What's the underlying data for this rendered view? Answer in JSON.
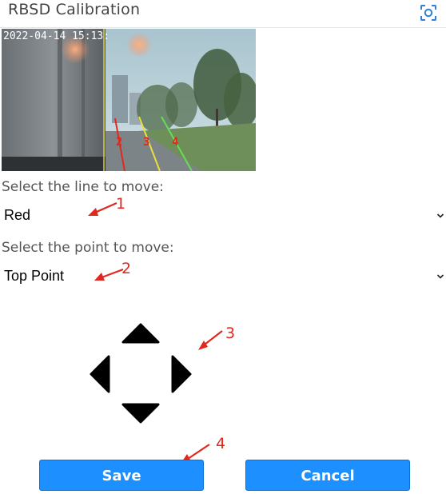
{
  "header": {
    "title": "RBSD Calibration",
    "scan_icon": "scan-focus-icon"
  },
  "camera": {
    "timestamp": "2022-04-14 15:13:",
    "line_labels": [
      "2",
      "3",
      "4"
    ],
    "line_colors": [
      "#e0281e",
      "#e8e040",
      "#66dd55"
    ]
  },
  "line_select": {
    "label": "Select the line to move:",
    "value": "Red"
  },
  "point_select": {
    "label": "Select the point to move:",
    "value": "Top Point"
  },
  "dpad": {
    "up_icon": "triangle-up-icon",
    "down_icon": "triangle-down-icon",
    "left_icon": "triangle-left-icon",
    "right_icon": "triangle-right-icon"
  },
  "callouts": {
    "one": "1",
    "two": "2",
    "three": "3",
    "four": "4",
    "color": "#e0281e"
  },
  "buttons": {
    "save": "Save",
    "cancel": "Cancel",
    "color": "#1e8fff"
  }
}
